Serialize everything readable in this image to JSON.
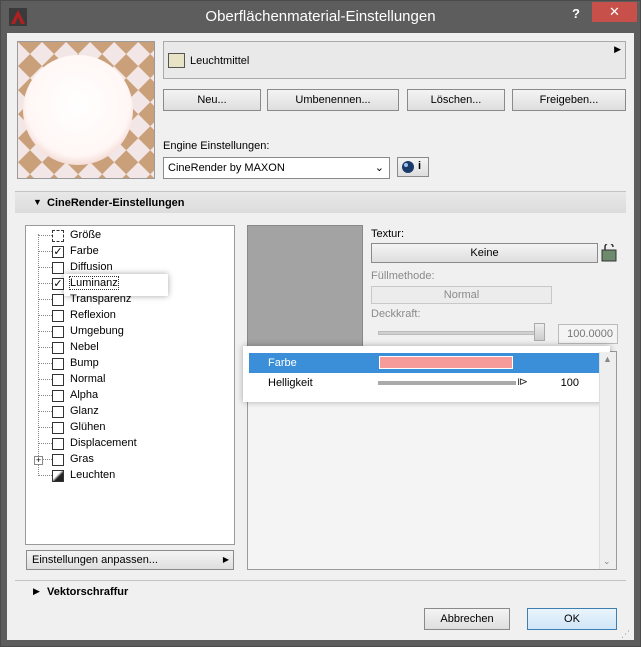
{
  "window": {
    "title": "Oberflächenmaterial-Einstellungen",
    "help": "?",
    "close": "✕"
  },
  "material": {
    "name": "Leuchtmittel",
    "swatch_color": "#e7e3c4"
  },
  "actions": {
    "new": "Neu...",
    "rename": "Umbenennen...",
    "delete": "Löschen...",
    "share": "Freigeben..."
  },
  "engine": {
    "label": "Engine Einstellungen:",
    "selected": "CineRender by MAXON",
    "info": "i"
  },
  "section": {
    "title": "CineRender-Einstellungen"
  },
  "channels": [
    {
      "label": "Größe",
      "checked": false
    },
    {
      "label": "Farbe",
      "checked": true
    },
    {
      "label": "Diffusion",
      "checked": false
    },
    {
      "label": "Luminanz",
      "checked": true
    },
    {
      "label": "Transparenz",
      "checked": false
    },
    {
      "label": "Reflexion",
      "checked": false
    },
    {
      "label": "Umgebung",
      "checked": false
    },
    {
      "label": "Nebel",
      "checked": false
    },
    {
      "label": "Bump",
      "checked": false
    },
    {
      "label": "Normal",
      "checked": false
    },
    {
      "label": "Alpha",
      "checked": false
    },
    {
      "label": "Glanz",
      "checked": false
    },
    {
      "label": "Glühen",
      "checked": false
    },
    {
      "label": "Displacement",
      "checked": false
    },
    {
      "label": "Gras",
      "checked": false
    },
    {
      "label": "Leuchten",
      "checked": false
    }
  ],
  "adjust": {
    "label": "Einstellungen anpassen..."
  },
  "texture": {
    "label": "Textur:",
    "button": "Keine",
    "fill_label": "Füllmethode:",
    "fill_value": "Normal",
    "opacity_label": "Deckkraft:",
    "opacity_value": "100.0000"
  },
  "params": {
    "color_label": "Farbe",
    "color_value": "#f69a9a",
    "brightness_label": "Helligkeit",
    "brightness_value": "100"
  },
  "vector": {
    "title": "Vektorschraffur"
  },
  "footer": {
    "cancel": "Abbrechen",
    "ok": "OK"
  }
}
